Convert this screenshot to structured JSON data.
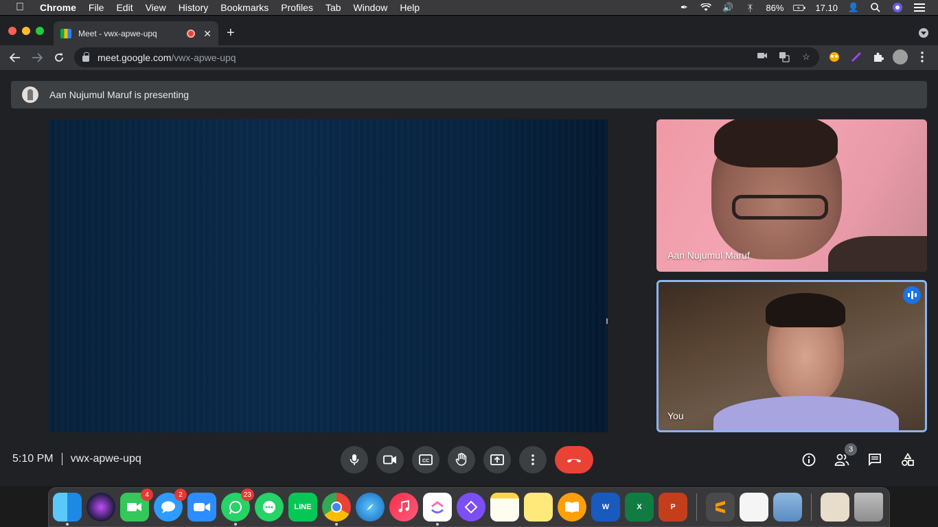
{
  "menubar": {
    "app_name": "Chrome",
    "items": [
      "File",
      "Edit",
      "View",
      "History",
      "Bookmarks",
      "Profiles",
      "Tab",
      "Window",
      "Help"
    ],
    "battery": "86%",
    "time": "17.10"
  },
  "browser": {
    "tab_title": "Meet - vwx-apwe-upq",
    "url_host": "meet.google.com",
    "url_path": "/vwx-apwe-upq"
  },
  "meet": {
    "presenting_text": "Aan Nujumul Maruf is presenting",
    "remote_name": "Aan Nujumul Maruf",
    "self_name": "You",
    "time": "5:10 PM",
    "meeting_code": "vwx-apwe-upq",
    "participants_count": "3"
  },
  "dock": {
    "facetime_badge": "4",
    "messages_badge": "2",
    "whatsapp_badge": "23",
    "line_label": "LINE"
  },
  "colors": {
    "end_call": "#ea4335",
    "speaking_indicator": "#1a73e8",
    "self_tile_border": "#8ab4f8"
  }
}
